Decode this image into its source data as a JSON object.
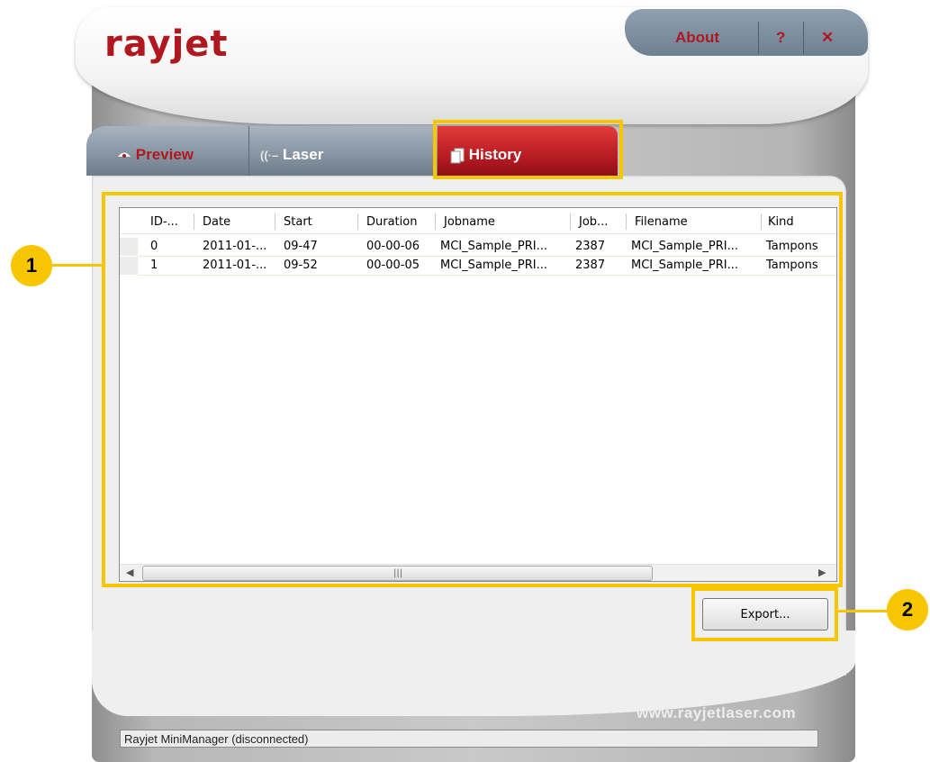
{
  "app": {
    "logo": "rayjet",
    "website": "www.rayjetlaser.com",
    "status": "Rayjet MiniManager (disconnected)"
  },
  "topbar": {
    "about": "About",
    "help": "?",
    "close": "✕"
  },
  "tabs": [
    {
      "label": "Preview",
      "icon": "eye-icon"
    },
    {
      "label": "Laser",
      "icon": "laser-beam-icon"
    },
    {
      "label": "History",
      "icon": "documents-icon",
      "active": true
    }
  ],
  "history_table": {
    "columns": [
      "ID-...",
      "Date",
      "Start",
      "Duration",
      "Jobname",
      "Job...",
      "Filename",
      "Kind"
    ],
    "rows": [
      [
        "0",
        "2011-01-...",
        "09-47",
        "00-00-06",
        "MCI_Sample_PRI...",
        "2387",
        "MCI_Sample_PRI...",
        "Tampons"
      ],
      [
        "1",
        "2011-01-...",
        "09-52",
        "00-00-05",
        "MCI_Sample_PRI...",
        "2387",
        "MCI_Sample_PRI...",
        "Tampons"
      ]
    ]
  },
  "export_button": "Export...",
  "callouts": [
    "1",
    "2"
  ],
  "colors": {
    "brand_red": "#b01820",
    "highlight": "#f7c600"
  }
}
